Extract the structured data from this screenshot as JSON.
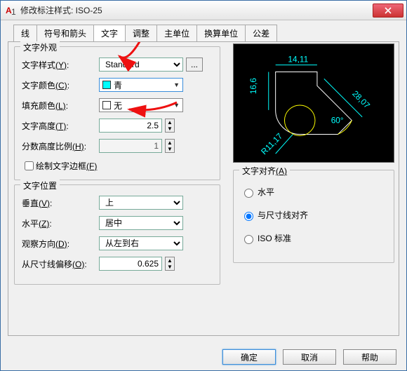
{
  "window": {
    "title": "修改标注样式: ISO-25",
    "app_icon_label": "A"
  },
  "tabs": {
    "items": [
      {
        "label": "线"
      },
      {
        "label": "符号和箭头"
      },
      {
        "label": "文字"
      },
      {
        "label": "调整"
      },
      {
        "label": "主单位"
      },
      {
        "label": "换算单位"
      },
      {
        "label": "公差"
      }
    ],
    "active_index": 2
  },
  "appearance": {
    "legend": "文字外观",
    "style_label": "文字样式",
    "style_hotkey": "(Y)",
    "style_value": "Standard",
    "style_browse": "...",
    "color_label": "文字颜色",
    "color_hotkey": "(C)",
    "color_value": "青",
    "color_hex": "#00ffff",
    "fill_label": "填充颜色",
    "fill_hotkey": "(L)",
    "fill_value": "无",
    "fill_swatch": "#ffffff",
    "height_label": "文字高度",
    "height_hotkey": "(T)",
    "height_value": "2.5",
    "frac_label": "分数高度比例",
    "frac_hotkey": "(H)",
    "frac_value": "1",
    "frame_label": "绘制文字边框",
    "frame_hotkey": "(F)",
    "frame_checked": false
  },
  "position": {
    "legend": "文字位置",
    "vert_label": "垂直",
    "vert_hotkey": "(V)",
    "vert_value": "上",
    "horiz_label": "水平",
    "horiz_hotkey": "(Z)",
    "horiz_value": "居中",
    "view_label": "观察方向",
    "view_hotkey": "(D)",
    "view_value": "从左到右",
    "offset_label": "从尺寸线偏移",
    "offset_hotkey": "(O)",
    "offset_value": "0.625"
  },
  "alignment": {
    "legend": "文字对齐",
    "hotkey": "(A)",
    "horiz": "水平",
    "dimline": "与尺寸线对齐",
    "iso": "ISO 标准",
    "selected": "dimline"
  },
  "preview": {
    "dims": {
      "top": "14,11",
      "left": "16,6",
      "radius": "R11,17",
      "diag": "28,07",
      "angle": "60°"
    }
  },
  "footer": {
    "ok": "确定",
    "cancel": "取消",
    "help": "帮助"
  }
}
